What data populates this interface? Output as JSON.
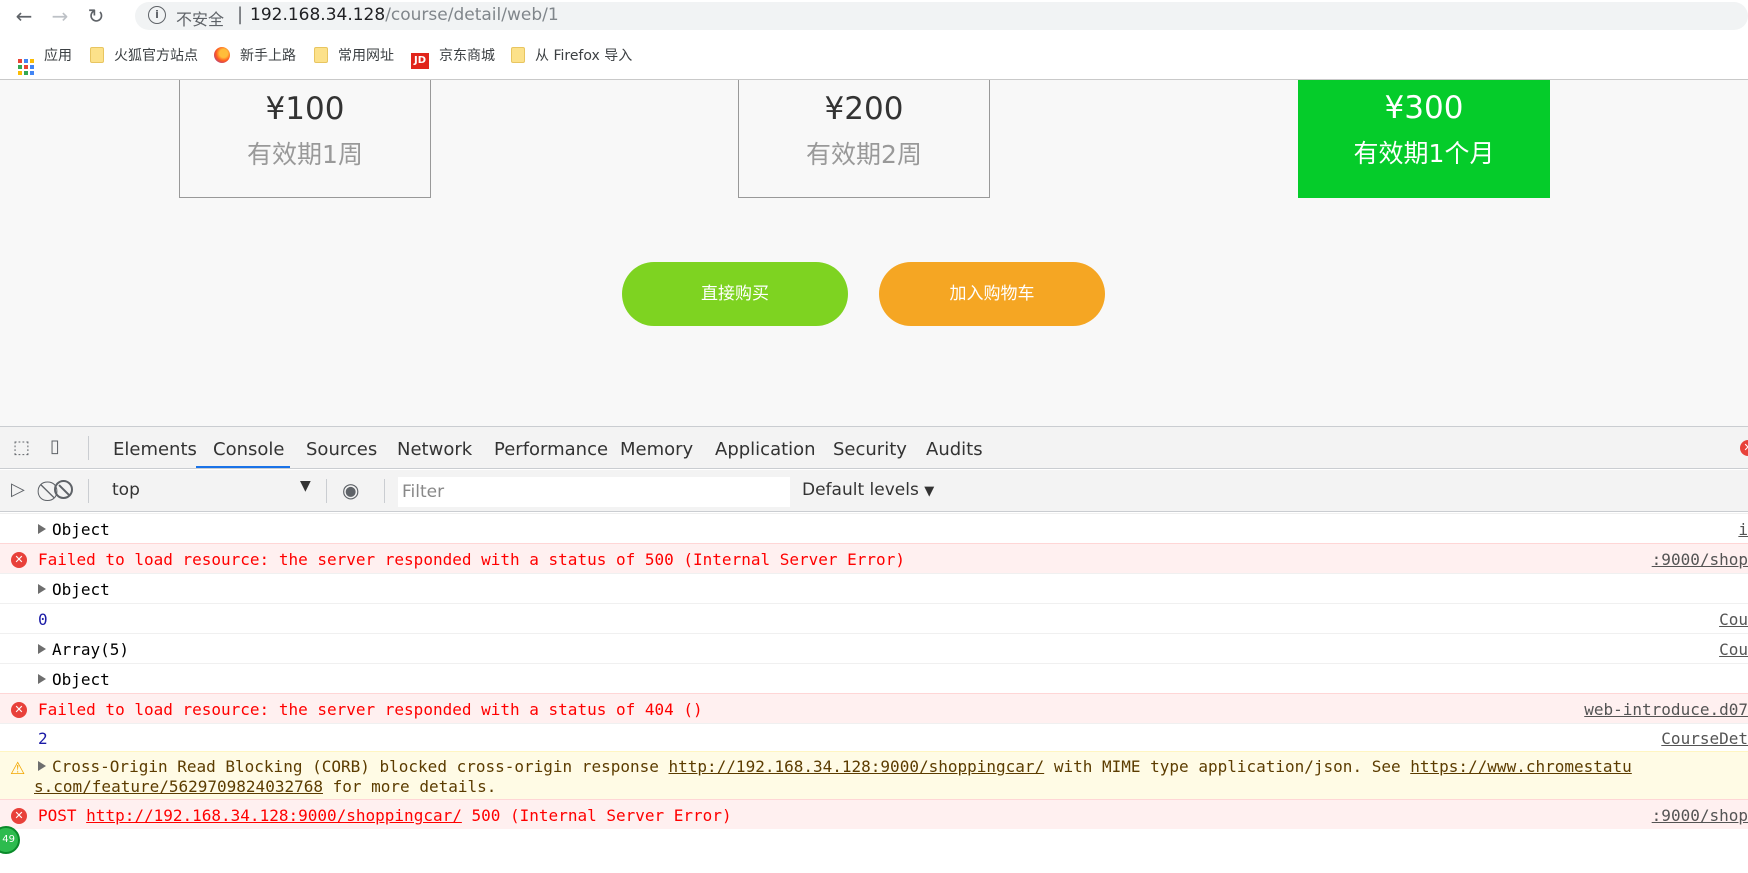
{
  "browser": {
    "insecure_label": "不安全",
    "url_host": "192.168.34.128",
    "url_path": "/course/detail/web/1",
    "bookmarks": [
      "应用",
      "火狐官方站点",
      "新手上路",
      "常用网址",
      "京东商城",
      "从 Firefox 导入"
    ],
    "badge": "49"
  },
  "page": {
    "plans": [
      {
        "price": "¥100",
        "period": "有效期1周",
        "selected": false
      },
      {
        "price": "¥200",
        "period": "有效期2周",
        "selected": false
      },
      {
        "price": "¥300",
        "period": "有效期1个月",
        "selected": true
      }
    ],
    "buy_now_label": "直接购买",
    "buy_now_color": "#7ed321",
    "add_cart_label": "加入购物车",
    "add_cart_color": "#f5a623"
  },
  "devtools": {
    "tabs": [
      "Elements",
      "Console",
      "Sources",
      "Network",
      "Performance",
      "Memory",
      "Application",
      "Security",
      "Audits"
    ],
    "active_tab": "Console",
    "context": "top",
    "filter_placeholder": "Filter",
    "levels_label": "Default levels",
    "console": {
      "r1_text": "Object",
      "r1_src": "i",
      "r2_text": "Failed to load resource: the server responded with a status of 500 (Internal Server Error)",
      "r2_src": ":9000/shop",
      "r3_text": "Object",
      "r4_text": "0",
      "r4_src": "Cou",
      "r5_text": "Array(5)",
      "r5_src": "Cou",
      "r6_text": "Object",
      "r7_text": "Failed to load resource: the server responded with a status of 404 ()",
      "r7_src": "web-introduce.d07",
      "r8_text": "2",
      "r8_src": "CourseDet",
      "r9_pre": "Cross-Origin Read Blocking (CORB) blocked cross-origin response ",
      "r9_link1": "http://192.168.34.128:9000/shoppingcar/",
      "r9_mid": " with MIME type application/json. See ",
      "r9_link2a": "https://www.chromestatu",
      "r9_link2b": "s.com/feature/5629709824032768",
      "r9_post": " for more details.",
      "r10_pre": "POST ",
      "r10_link": "http://192.168.34.128:9000/shoppingcar/",
      "r10_post": " 500 (Internal Server Error)",
      "r10_src": ":9000/shop"
    }
  }
}
